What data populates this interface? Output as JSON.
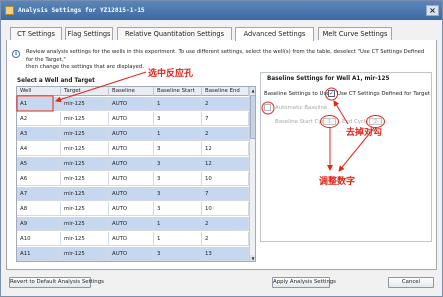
{
  "window": {
    "title": "Analysis Settings for YZ12815-1-15"
  },
  "tabs": [
    {
      "label": "CT Settings"
    },
    {
      "label": "Flag Settings"
    },
    {
      "label": "Relative Quantitation Settings"
    },
    {
      "label": "Advanced Settings"
    },
    {
      "label": "Melt Curve Settings"
    }
  ],
  "info": {
    "line1": "Review analysis settings for the wells in this experiment. To use different settings, select the well(s) from the table, deselect \"Use CT Settings Defined for the Target,\"",
    "line2": "then change the settings that are displayed."
  },
  "table": {
    "title": "Select a Well and Target",
    "columns": [
      "Well",
      "Target",
      "Baseline",
      "Baseline Start",
      "Baseline End"
    ],
    "rows": [
      [
        "A1",
        "mir-125",
        "AUTO",
        "1",
        "2"
      ],
      [
        "A2",
        "mir-125",
        "AUTO",
        "3",
        "7"
      ],
      [
        "A3",
        "mir-125",
        "AUTO",
        "1",
        "2"
      ],
      [
        "A4",
        "mir-125",
        "AUTO",
        "3",
        "12"
      ],
      [
        "A5",
        "mir-125",
        "AUTO",
        "3",
        "12"
      ],
      [
        "A6",
        "mir-125",
        "AUTO",
        "3",
        "10"
      ],
      [
        "A7",
        "mir-125",
        "AUTO",
        "3",
        "7"
      ],
      [
        "A8",
        "mir-125",
        "AUTO",
        "3",
        "10"
      ],
      [
        "A9",
        "mir-125",
        "AUTO",
        "1",
        "2"
      ],
      [
        "A10",
        "mir-125",
        "AUTO",
        "1",
        "2"
      ],
      [
        "A11",
        "mir-125",
        "AUTO",
        "3",
        "13"
      ]
    ]
  },
  "baseline_panel": {
    "title": "Baseline Settings for Well A1, mir-125",
    "use_settings_prefix": "Baseline Settings to Use:",
    "use_ct_settings_label": "Use CT Settings Defined for Target",
    "use_ct_settings_checked": true,
    "automatic_baseline_label": "Automatic Baseline",
    "baseline_start_label": "Baseline Start Cycle",
    "baseline_start_value": "1",
    "end_cycle_label": "End Cycle",
    "end_cycle_value": "2"
  },
  "buttons": {
    "revert": "Revert to Default Analysis Settings",
    "apply": "Apply Analysis Settings",
    "cancel": "Cancel"
  },
  "annotations": {
    "select_well": "选中反应孔",
    "uncheck": "去掉对勾",
    "adjust_numbers": "调整数字"
  },
  "colors": {
    "title_bar": "#4a77ae",
    "selected_row": "#c6d8ef",
    "annotation": "#e0261b"
  },
  "icons": {
    "info": "info-icon",
    "close": "close-icon",
    "scroll_up": "scroll-up-arrow-icon",
    "scroll_down": "scroll-down-arrow-icon"
  }
}
